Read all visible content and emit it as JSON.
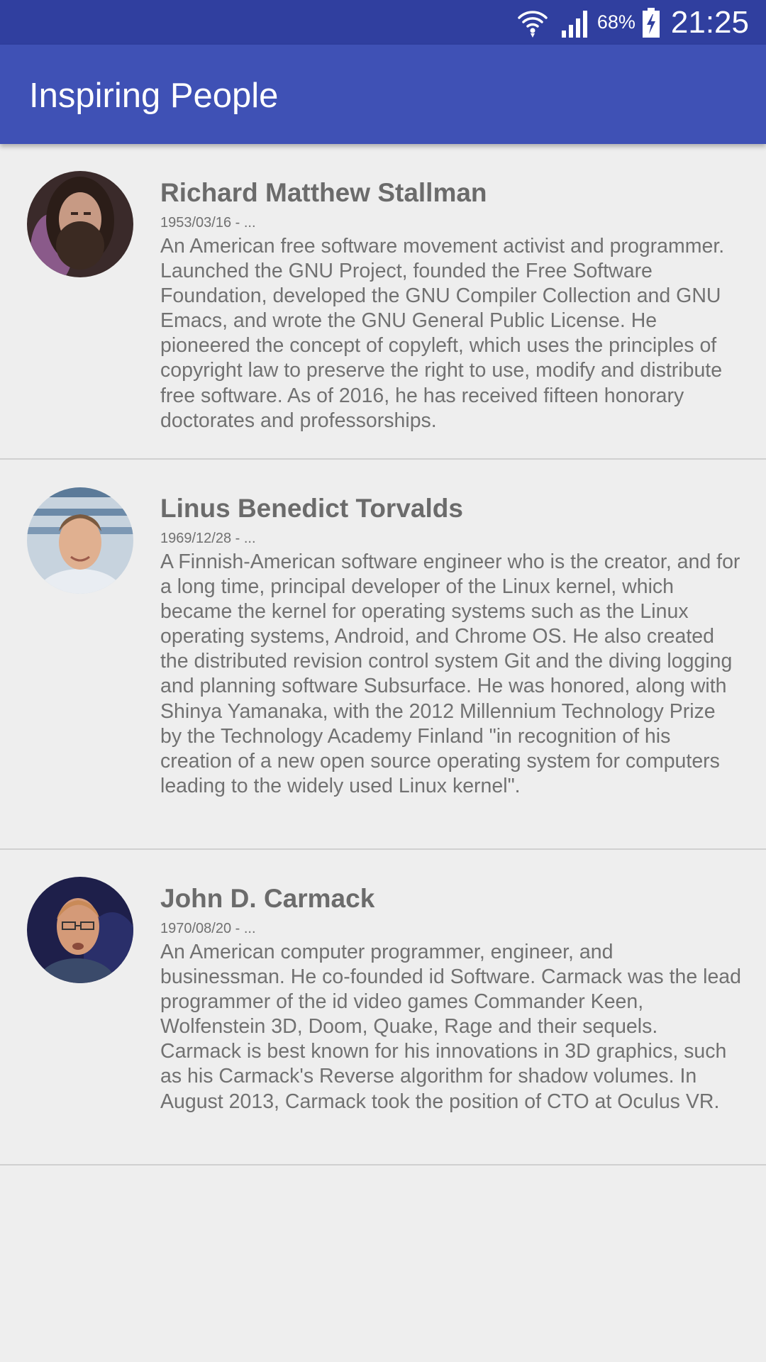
{
  "status_bar": {
    "battery_percent": "68%",
    "time": "21:25",
    "icons": [
      "wifi-icon",
      "signal-icon",
      "battery-charging-icon"
    ]
  },
  "app_bar": {
    "title": "Inspiring People"
  },
  "people": [
    {
      "name": "Richard Matthew Stallman",
      "dates": "1953/03/16 - ...",
      "bio": "An American free software movement activist and programmer. Launched the GNU Project, founded the Free Software Foundation, developed the GNU Compiler Collection and GNU Emacs, and wrote the GNU General Public License. He pioneered the concept of copyleft, which uses the principles of copyright law to preserve the right to use, modify and distribute free software. As of 2016, he has received fifteen honorary doctorates and professorships."
    },
    {
      "name": "Linus Benedict Torvalds",
      "dates": "1969/12/28 - ...",
      "bio": "A Finnish-American software engineer who is the creator, and for a long time, principal developer of the Linux kernel, which became the kernel for operating systems such as the Linux operating systems, Android, and Chrome OS. He also created the distributed revision control system Git and the diving logging and planning software Subsurface. He was honored, along with Shinya Yamanaka, with the 2012 Millennium Technology Prize by the Technology Academy Finland \"in recognition of his creation of a new open source operating system for computers leading to the widely used Linux kernel\"."
    },
    {
      "name": "John D. Carmack",
      "dates": "1970/08/20 - ...",
      "bio": "An American computer programmer, engineer, and businessman. He co-founded id Software. Carmack was the lead programmer of the id video games Commander Keen, Wolfenstein 3D, Doom, Quake, Rage and their sequels. Carmack is best known for his innovations in 3D graphics, such as his Carmack's Reverse algorithm for shadow volumes. In August 2013, Carmack took the position of CTO at Oculus VR."
    }
  ],
  "colors": {
    "status_bar": "#303f9f",
    "app_bar": "#3f51b5",
    "background": "#eeeeee",
    "text": "#6e6e6e"
  }
}
